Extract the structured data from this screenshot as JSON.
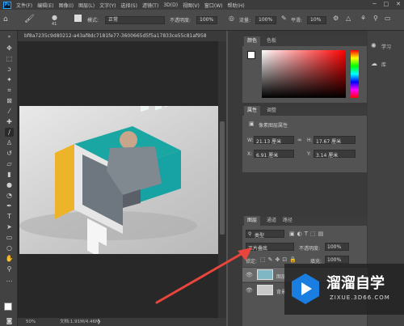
{
  "menubar": {
    "items": [
      "文件(F)",
      "编辑(E)",
      "图像(I)",
      "图层(L)",
      "文字(Y)",
      "选择(S)",
      "滤镜(T)",
      "3D(D)",
      "视图(V)",
      "窗口(W)",
      "帮助(H)"
    ]
  },
  "options": {
    "mode_label": "模式:",
    "mode_value": "正常",
    "opacity_label": "不透明度:",
    "opacity_value": "100%",
    "flow_label": "流量:",
    "flow_value": "100%",
    "smooth_label": "平滑:",
    "smooth_value": "10%",
    "brush_size": "41"
  },
  "document": {
    "tab_title": "bf8a7235c9d80212-a43af8dc7181fe77-3600665d5f5a17833ce55c81af958",
    "zoom": "50%",
    "doc_info": "文档:1.91M/4.46M"
  },
  "color_panel": {
    "tabs": [
      "颜色",
      "色板"
    ]
  },
  "properties_panel": {
    "tabs": [
      "属性",
      "调整"
    ],
    "title": "像素图层属性",
    "w_label": "W:",
    "w_value": "21.13 厘米",
    "h_label": "H:",
    "h_value": "17.67 厘米",
    "x_label": "X:",
    "x_value": "6.91 厘米",
    "y_label": "Y:",
    "y_value": "3.14 厘米",
    "link": "∞"
  },
  "layers_panel": {
    "tabs": [
      "图层",
      "通道",
      "路径"
    ],
    "kind": "类型",
    "blend_mode": "正片叠底",
    "opacity_label": "不透明度:",
    "opacity_value": "100%",
    "lock_label": "锁定:",
    "fill_label": "填充:",
    "fill_value": "100%",
    "layers": [
      {
        "name": "图层"
      },
      {
        "name": "背景"
      }
    ]
  },
  "learn_panel": {
    "items": [
      "学习",
      "库"
    ]
  },
  "watermark": {
    "title": "溜溜自学",
    "url": "ZIXUE.3D66.COM"
  },
  "colors": {
    "accent": "#31a8ff",
    "arrow": "#e8453c"
  }
}
